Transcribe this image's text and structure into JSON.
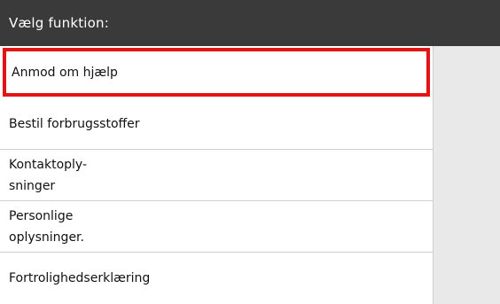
{
  "header": {
    "title": "Vælg funktion:"
  },
  "menu": {
    "items": [
      {
        "label": "Anmod om hjælp",
        "selected": true
      },
      {
        "label": "Bestil forbrugsstoffer",
        "selected": false
      },
      {
        "label": "Kontaktoply-\nsninger",
        "selected": false
      },
      {
        "label": "Personlige\noplysninger.",
        "selected": false
      },
      {
        "label": "Fortrolighedserklæring",
        "selected": false
      }
    ]
  },
  "colors": {
    "header_background": "#3a3a3a",
    "selection_border": "#e31414",
    "panel_background": "#ffffff",
    "side_background": "#e9e9e9"
  }
}
